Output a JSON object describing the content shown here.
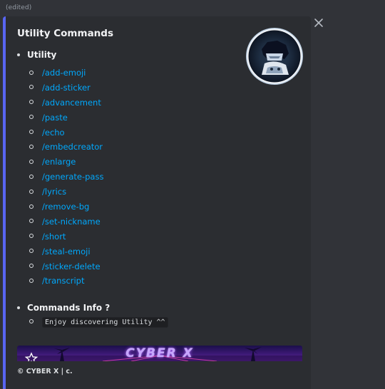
{
  "message": {
    "edited_label": "(edited)"
  },
  "embed": {
    "accent_color": "#5865f2",
    "title": "Utility Commands",
    "sections": {
      "utility_heading": "Utility",
      "commands": [
        "/add-emoji",
        "/add-sticker",
        "/advancement",
        "/paste",
        "/echo",
        "/embedcreator",
        "/enlarge",
        "/generate-pass",
        "/lyrics",
        "/remove-bg",
        "/set-nickname",
        "/short",
        "/steal-emoji",
        "/sticker-delete",
        "/transcript"
      ],
      "info_heading": "Commands Info ?",
      "info_text": "Enjoy discovering Utility ^^"
    },
    "banner_text": "CYBER X",
    "footer": "© CYBER X | c."
  },
  "icons": {
    "close": "close-icon",
    "star": "star-icon"
  }
}
